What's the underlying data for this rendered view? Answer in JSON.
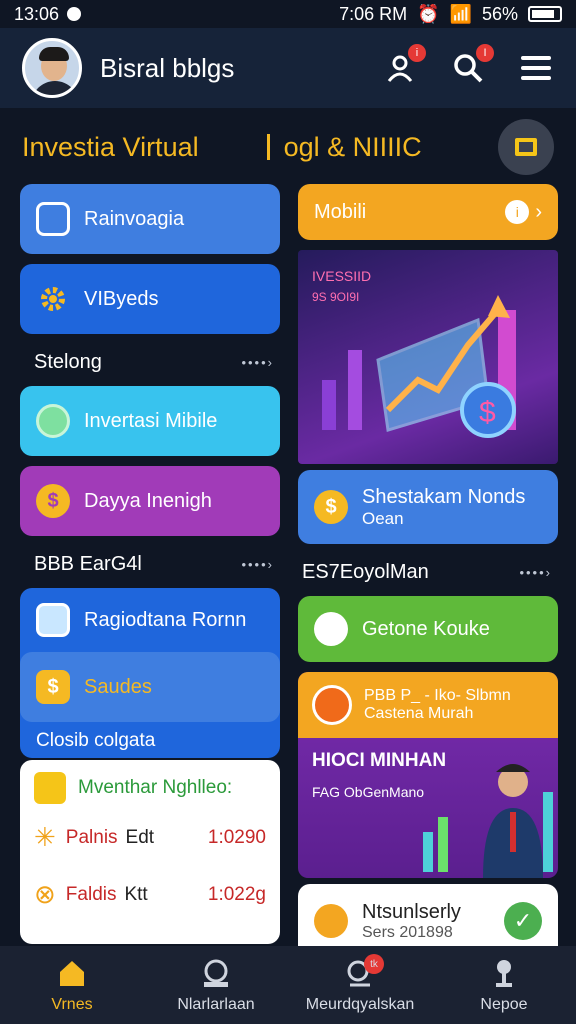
{
  "status_bar": {
    "time_left": "13:06",
    "time_right": "7:06 RM",
    "battery": "56%"
  },
  "header": {
    "username": "Bisral bblgs",
    "notif_badge": "i",
    "search_badge": "I"
  },
  "titles": {
    "left": "Investia Virtual",
    "right": "ogl & NIIIIC"
  },
  "left": {
    "tile1": "Rainvoagia",
    "tile2": "VIByeds",
    "subhead1": "Stelong",
    "subhead1_more": "••••›",
    "tile3": "Invertasi Mibile",
    "tile4": "Dayya Inenigh",
    "subhead2": "BBB EarG4l",
    "subhead2_more": "••••›",
    "panel1_tile": "Ragiodtana Rornn",
    "panel1_sub": "Saudes",
    "panel1_foot": "Closib colgata",
    "card_title": "Mventhar Nghlleo:",
    "rows": [
      {
        "label": "Palnis",
        "sub": "Edt",
        "value": "1:0290"
      },
      {
        "label": "Faldis",
        "sub": "Ktt",
        "value": "1:022g"
      }
    ]
  },
  "right": {
    "top_tile": "Mobili",
    "banner_text1": "IVESSIID",
    "banner_text2": "9S 9OI9I",
    "card1_title": "Shestakam Nonds",
    "card1_sub": "Oean",
    "subhead": "ES7EoyolMan",
    "subhead_more": "••••›",
    "card2_title": "Getone Kouke",
    "card3_title": "PBB P_ - Iko- Slbmn",
    "card3_sub": "Castena Murah",
    "promo_title": "HIOCI MINHAN",
    "promo_sub": "FAG ObGenMano",
    "card4_title": "Ntsunlserly",
    "card4_sub": "Sers 201898"
  },
  "nav": [
    {
      "label": "Vrnes",
      "active": true
    },
    {
      "label": "Nlarlarlaan",
      "active": false
    },
    {
      "label": "Meurdqyalskan",
      "active": false,
      "badge": "tk"
    },
    {
      "label": "Nepoe",
      "active": false
    }
  ],
  "colors": {
    "accent": "#f5b923",
    "blue": "#2b74e8",
    "purple": "#a13bb8",
    "green": "#5fba3a",
    "orange": "#f3a621",
    "cyan": "#38c3ee"
  }
}
